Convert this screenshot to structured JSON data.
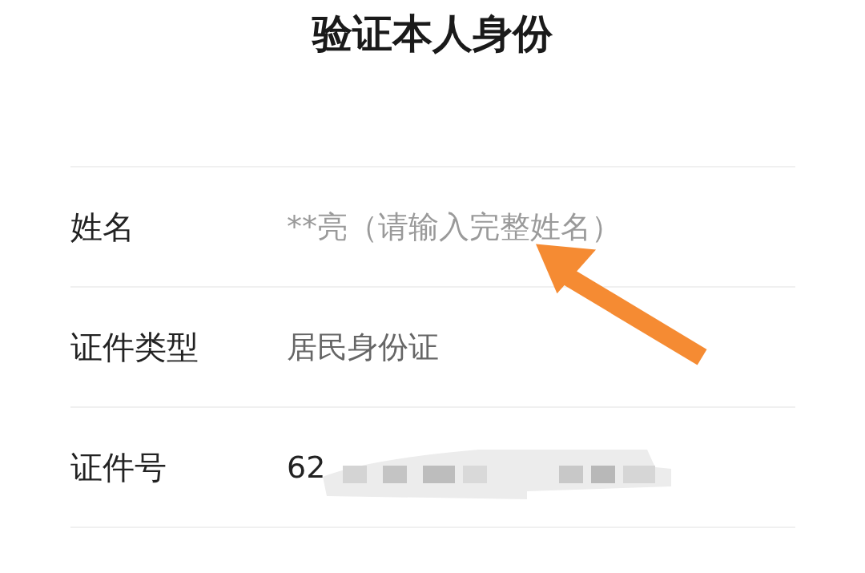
{
  "title": "验证本人身份",
  "fields": [
    {
      "label": "姓名",
      "placeholder": "**亮（请输入完整姓名）"
    },
    {
      "label": "证件类型",
      "value": "居民身份证",
      "kind": "select"
    },
    {
      "label": "证件号",
      "value": "62",
      "redacted": true,
      "kind": "text"
    }
  ]
}
